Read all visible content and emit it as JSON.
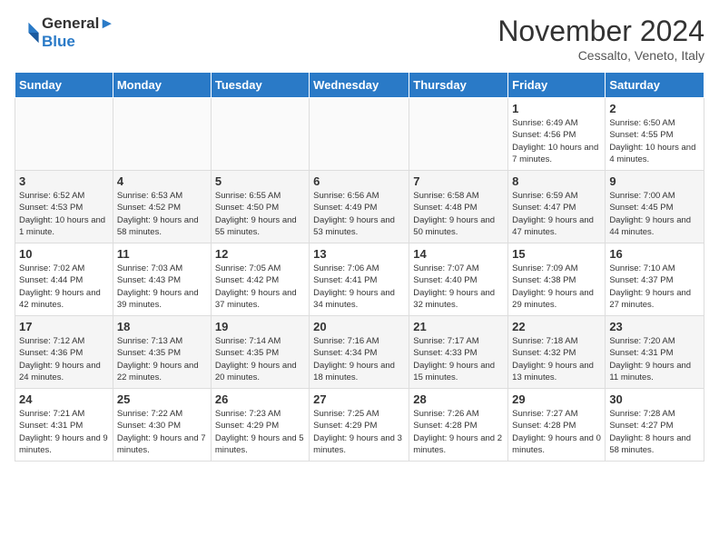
{
  "header": {
    "logo_line1": "General",
    "logo_line2": "Blue",
    "month_title": "November 2024",
    "subtitle": "Cessalto, Veneto, Italy"
  },
  "weekdays": [
    "Sunday",
    "Monday",
    "Tuesday",
    "Wednesday",
    "Thursday",
    "Friday",
    "Saturday"
  ],
  "weeks": [
    [
      {
        "day": "",
        "info": ""
      },
      {
        "day": "",
        "info": ""
      },
      {
        "day": "",
        "info": ""
      },
      {
        "day": "",
        "info": ""
      },
      {
        "day": "",
        "info": ""
      },
      {
        "day": "1",
        "info": "Sunrise: 6:49 AM\nSunset: 4:56 PM\nDaylight: 10 hours and 7 minutes."
      },
      {
        "day": "2",
        "info": "Sunrise: 6:50 AM\nSunset: 4:55 PM\nDaylight: 10 hours and 4 minutes."
      }
    ],
    [
      {
        "day": "3",
        "info": "Sunrise: 6:52 AM\nSunset: 4:53 PM\nDaylight: 10 hours and 1 minute."
      },
      {
        "day": "4",
        "info": "Sunrise: 6:53 AM\nSunset: 4:52 PM\nDaylight: 9 hours and 58 minutes."
      },
      {
        "day": "5",
        "info": "Sunrise: 6:55 AM\nSunset: 4:50 PM\nDaylight: 9 hours and 55 minutes."
      },
      {
        "day": "6",
        "info": "Sunrise: 6:56 AM\nSunset: 4:49 PM\nDaylight: 9 hours and 53 minutes."
      },
      {
        "day": "7",
        "info": "Sunrise: 6:58 AM\nSunset: 4:48 PM\nDaylight: 9 hours and 50 minutes."
      },
      {
        "day": "8",
        "info": "Sunrise: 6:59 AM\nSunset: 4:47 PM\nDaylight: 9 hours and 47 minutes."
      },
      {
        "day": "9",
        "info": "Sunrise: 7:00 AM\nSunset: 4:45 PM\nDaylight: 9 hours and 44 minutes."
      }
    ],
    [
      {
        "day": "10",
        "info": "Sunrise: 7:02 AM\nSunset: 4:44 PM\nDaylight: 9 hours and 42 minutes."
      },
      {
        "day": "11",
        "info": "Sunrise: 7:03 AM\nSunset: 4:43 PM\nDaylight: 9 hours and 39 minutes."
      },
      {
        "day": "12",
        "info": "Sunrise: 7:05 AM\nSunset: 4:42 PM\nDaylight: 9 hours and 37 minutes."
      },
      {
        "day": "13",
        "info": "Sunrise: 7:06 AM\nSunset: 4:41 PM\nDaylight: 9 hours and 34 minutes."
      },
      {
        "day": "14",
        "info": "Sunrise: 7:07 AM\nSunset: 4:40 PM\nDaylight: 9 hours and 32 minutes."
      },
      {
        "day": "15",
        "info": "Sunrise: 7:09 AM\nSunset: 4:38 PM\nDaylight: 9 hours and 29 minutes."
      },
      {
        "day": "16",
        "info": "Sunrise: 7:10 AM\nSunset: 4:37 PM\nDaylight: 9 hours and 27 minutes."
      }
    ],
    [
      {
        "day": "17",
        "info": "Sunrise: 7:12 AM\nSunset: 4:36 PM\nDaylight: 9 hours and 24 minutes."
      },
      {
        "day": "18",
        "info": "Sunrise: 7:13 AM\nSunset: 4:35 PM\nDaylight: 9 hours and 22 minutes."
      },
      {
        "day": "19",
        "info": "Sunrise: 7:14 AM\nSunset: 4:35 PM\nDaylight: 9 hours and 20 minutes."
      },
      {
        "day": "20",
        "info": "Sunrise: 7:16 AM\nSunset: 4:34 PM\nDaylight: 9 hours and 18 minutes."
      },
      {
        "day": "21",
        "info": "Sunrise: 7:17 AM\nSunset: 4:33 PM\nDaylight: 9 hours and 15 minutes."
      },
      {
        "day": "22",
        "info": "Sunrise: 7:18 AM\nSunset: 4:32 PM\nDaylight: 9 hours and 13 minutes."
      },
      {
        "day": "23",
        "info": "Sunrise: 7:20 AM\nSunset: 4:31 PM\nDaylight: 9 hours and 11 minutes."
      }
    ],
    [
      {
        "day": "24",
        "info": "Sunrise: 7:21 AM\nSunset: 4:31 PM\nDaylight: 9 hours and 9 minutes."
      },
      {
        "day": "25",
        "info": "Sunrise: 7:22 AM\nSunset: 4:30 PM\nDaylight: 9 hours and 7 minutes."
      },
      {
        "day": "26",
        "info": "Sunrise: 7:23 AM\nSunset: 4:29 PM\nDaylight: 9 hours and 5 minutes."
      },
      {
        "day": "27",
        "info": "Sunrise: 7:25 AM\nSunset: 4:29 PM\nDaylight: 9 hours and 3 minutes."
      },
      {
        "day": "28",
        "info": "Sunrise: 7:26 AM\nSunset: 4:28 PM\nDaylight: 9 hours and 2 minutes."
      },
      {
        "day": "29",
        "info": "Sunrise: 7:27 AM\nSunset: 4:28 PM\nDaylight: 9 hours and 0 minutes."
      },
      {
        "day": "30",
        "info": "Sunrise: 7:28 AM\nSunset: 4:27 PM\nDaylight: 8 hours and 58 minutes."
      }
    ]
  ]
}
